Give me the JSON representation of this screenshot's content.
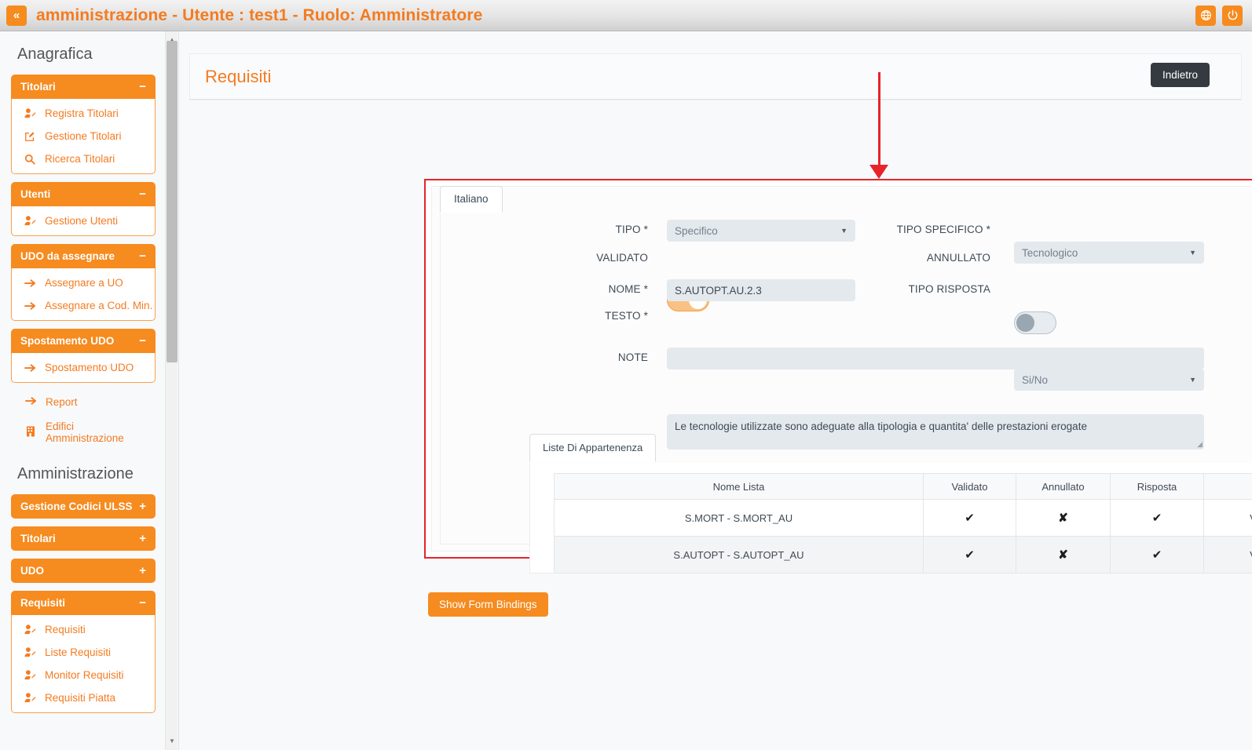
{
  "topbar": {
    "collapse_label": "«",
    "title": "amministrazione - Utente : test1 - Ruolo: Amministratore",
    "language_icon": "globe-icon",
    "power_icon": "power-icon",
    "accent": "#f47b20"
  },
  "sidebar": {
    "headings": {
      "anagrafica": "Anagrafica",
      "amministrazione": "Amministrazione"
    },
    "groups": [
      {
        "label": "Titolari",
        "sign": "−",
        "open": true,
        "items": [
          {
            "label": "Registra Titolari",
            "icon": "user-edit-icon"
          },
          {
            "label": "Gestione Titolari",
            "icon": "pencil-square-icon"
          },
          {
            "label": "Ricerca Titolari",
            "icon": "search-icon"
          }
        ]
      },
      {
        "label": "Utenti",
        "sign": "−",
        "open": true,
        "items": [
          {
            "label": "Gestione Utenti",
            "icon": "user-edit-icon"
          }
        ]
      },
      {
        "label": "UDO da assegnare",
        "sign": "−",
        "open": true,
        "items": [
          {
            "label": "Assegnare a UO",
            "icon": "arrow-right-icon"
          },
          {
            "label": "Assegnare a Cod. Min.",
            "icon": "arrow-right-icon"
          }
        ]
      },
      {
        "label": "Spostamento UDO",
        "sign": "−",
        "open": true,
        "items": [
          {
            "label": "Spostamento UDO",
            "icon": "arrow-right-icon"
          }
        ]
      }
    ],
    "flat_items": [
      {
        "label": "Report",
        "icon": "arrow-right-icon"
      },
      {
        "label": "Edifici Amministrazione",
        "icon": "building-icon"
      }
    ],
    "groups2": [
      {
        "label": "Gestione Codici ULSS",
        "sign": "+",
        "open": false,
        "items": []
      },
      {
        "label": "Titolari",
        "sign": "+",
        "open": false,
        "items": []
      },
      {
        "label": "UDO",
        "sign": "+",
        "open": false,
        "items": []
      },
      {
        "label": "Requisiti",
        "sign": "−",
        "open": true,
        "items": [
          {
            "label": "Requisiti",
            "icon": "user-edit-icon"
          },
          {
            "label": "Liste Requisiti",
            "icon": "user-edit-icon"
          },
          {
            "label": "Monitor Requisiti",
            "icon": "user-edit-icon"
          },
          {
            "label": "Requisiti Piatta",
            "icon": "user-edit-icon"
          }
        ]
      }
    ]
  },
  "page": {
    "title": "Requisiti",
    "back_button": "Indietro",
    "show_bindings_button": "Show Form Bindings"
  },
  "form": {
    "language_tab": "Italiano",
    "fields": {
      "tipo": {
        "label": "TIPO *",
        "value": "Specifico",
        "control": "select"
      },
      "tipo_specifico": {
        "label": "TIPO SPECIFICO *",
        "value": "Tecnologico",
        "control": "select"
      },
      "validato": {
        "label": "VALIDATO",
        "value": "on",
        "control": "toggle"
      },
      "annullato": {
        "label": "ANNULLATO",
        "value": "off",
        "control": "toggle"
      },
      "nome": {
        "label": "NOME *",
        "value": "S.AUTOPT.AU.2.3",
        "control": "text"
      },
      "tipo_risposta": {
        "label": "TIPO RISPOSTA",
        "value": "Si/No",
        "control": "select"
      },
      "testo": {
        "label": "TESTO *",
        "value": "Le tecnologie utilizzate sono adeguate alla tipologia e quantita' delle prestazioni erogate",
        "control": "textarea"
      },
      "note": {
        "label": "NOTE",
        "value": "",
        "control": "text"
      }
    }
  },
  "liste": {
    "tab_label": "Liste Di Appartenenza",
    "columns": [
      "Nome Lista",
      "Validato",
      "Annullato",
      "Risposta",
      ""
    ],
    "rows": [
      {
        "nome": "S.MORT - S.MORT_AU",
        "validato": "✔",
        "annullato": "✘",
        "risposta": "✔",
        "action": "Vai"
      },
      {
        "nome": "S.AUTOPT - S.AUTOPT_AU",
        "validato": "✔",
        "annullato": "✘",
        "risposta": "✔",
        "action": "Vai"
      }
    ]
  },
  "annotation": {
    "color": "#e8232a",
    "shape": "down-arrow-to-form"
  }
}
